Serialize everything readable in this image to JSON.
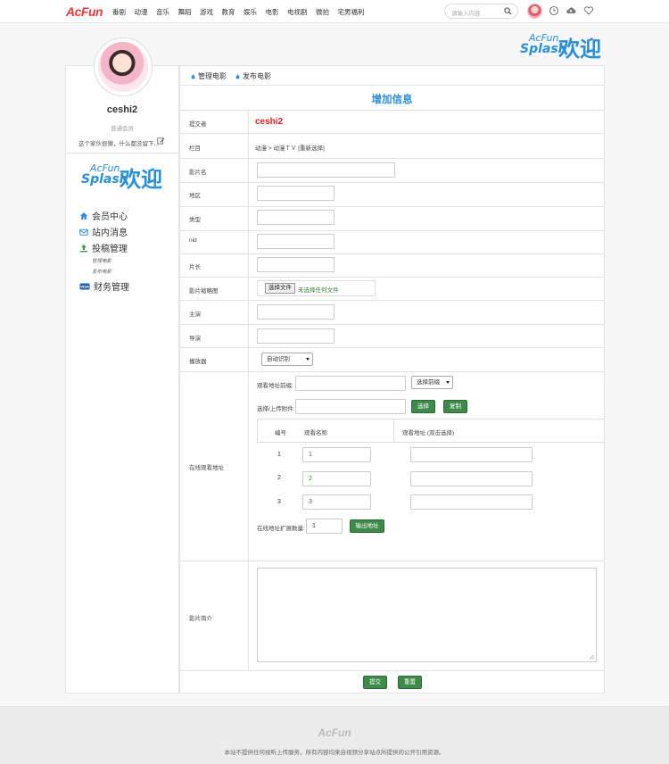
{
  "header": {
    "logo": "AcFun",
    "nav": [
      "番剧",
      "动漫",
      "音乐",
      "舞蹈",
      "游戏",
      "教育",
      "娱乐",
      "电影",
      "电视剧",
      "微拍",
      "宅男福利"
    ],
    "search_placeholder": "请输入内容"
  },
  "splash_logo": {
    "acfun": "AcFun",
    "splash": "Splash",
    "welcome": "欢迎"
  },
  "sidebar": {
    "username": "ceshi2",
    "level": "普通会员",
    "signature": "这个家伙很懒，什么都没留下...",
    "menu": [
      "会员中心",
      "站内消息",
      "投稿管理",
      "财务管理"
    ],
    "submenu": [
      "管理电影",
      "发布电影"
    ]
  },
  "breadcrumb": [
    "管理电影",
    "发布电影"
  ],
  "form": {
    "title": "增加信息",
    "labels": {
      "submitter": "提交者",
      "column": "栏目",
      "name": "影片名",
      "region": "地区",
      "type": "类型",
      "nid": "nid",
      "duration": "片长",
      "thumbnail": "影片缩略图",
      "actor": "主演",
      "director": "导演",
      "player": "播放器",
      "watch_address": "在线观看地址",
      "intro": "影片简介"
    },
    "submitter_value": "ceshi2",
    "column_value": "动漫 > 动漫ＴＶ [重新选择]",
    "file_button": "选择文件",
    "file_status": "未选择任何文件",
    "player_select": "自动识别",
    "watch": {
      "prefix_label": "观看地址前缀:",
      "prefix_select": "选择前缀",
      "upload_label": "选择/上传附件:",
      "select_button": "选择",
      "copy_button": "复制",
      "col_no": "编号",
      "col_name": "观看名称",
      "col_address": "观看地址 (双击选择)",
      "rows": [
        {
          "no": "1",
          "name": "1"
        },
        {
          "no": "2",
          "name": "2"
        },
        {
          "no": "3",
          "name": "3"
        }
      ],
      "expand_label": "在线地址扩展数量:",
      "expand_value": "1",
      "output_button": "输出地址"
    },
    "submit_button": "提交",
    "reset_button": "重置"
  },
  "footer": {
    "logo": "AcFun",
    "text": "本站不提供任何视听上传服务，所有内容均来自视频分享站点所提供的公开引用资源。"
  },
  "colors": {
    "accent": "#2a8fd9",
    "button": "#3e8a4a",
    "logo_red": "#e53a3a"
  }
}
